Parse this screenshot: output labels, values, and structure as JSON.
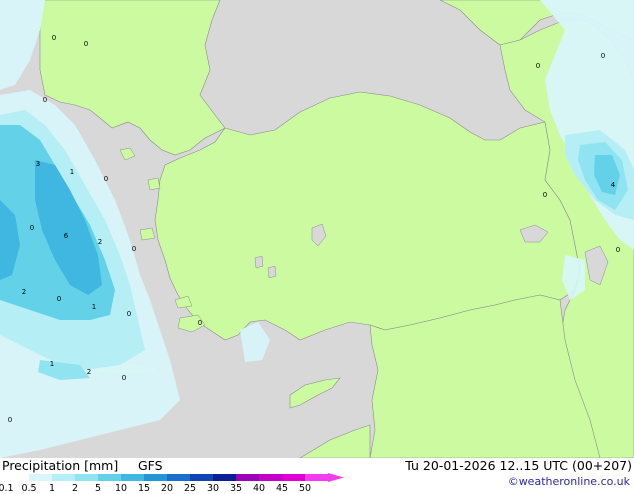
{
  "product": {
    "title": "Precipitation [mm]",
    "model": "GFS",
    "valid_time": "Tu 20-01-2026 12..15 UTC (00+207)",
    "credit": "©weatheronline.co.uk"
  },
  "legend": {
    "levels": [
      {
        "label": "0.1",
        "color": "#ffffff"
      },
      {
        "label": "0.5",
        "color": "#d8f6fb"
      },
      {
        "label": "1",
        "color": "#b6eef6"
      },
      {
        "label": "2",
        "color": "#90e3f0"
      },
      {
        "label": "5",
        "color": "#63d2e9"
      },
      {
        "label": "10",
        "color": "#3fb7e0"
      },
      {
        "label": "15",
        "color": "#2496d6"
      },
      {
        "label": "20",
        "color": "#1a6fcc"
      },
      {
        "label": "25",
        "color": "#1244b4"
      },
      {
        "label": "30",
        "color": "#0b1e96"
      },
      {
        "label": "35",
        "color": "#9b00b6"
      },
      {
        "label": "40",
        "color": "#c400c8"
      },
      {
        "label": "45",
        "color": "#e000d6"
      },
      {
        "label": "50",
        "color": "#f23cf0"
      }
    ]
  },
  "map": {
    "land_color": "#ccfaa0",
    "sea_color": "#d8d8d8",
    "coast_color": "#8c8c8c",
    "value_labels": [
      "0",
      "0",
      "0",
      "0",
      "0",
      "3",
      "1",
      "0",
      "0",
      "6",
      "2",
      "0",
      "2",
      "0",
      "1",
      "0",
      "1",
      "2",
      "0",
      "0",
      "0",
      "4",
      "0",
      "0"
    ]
  }
}
